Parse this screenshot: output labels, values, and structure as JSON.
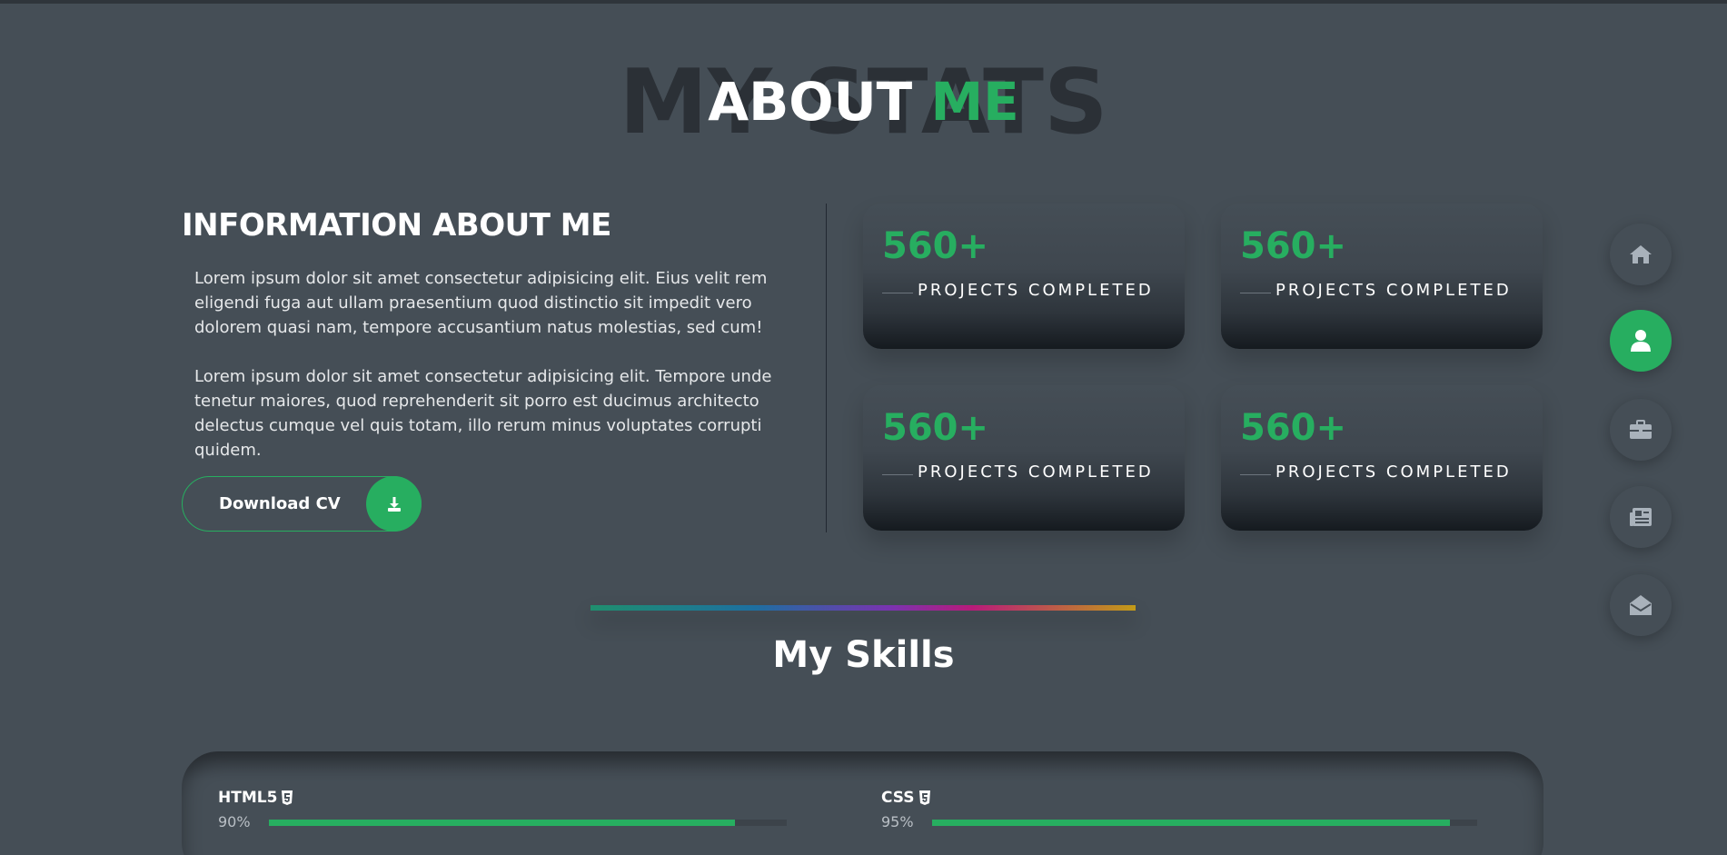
{
  "header": {
    "bg_text": "MY STATS",
    "title_main": "ABOUT",
    "title_accent": "ME"
  },
  "info": {
    "title": "INFORMATION ABOUT ME",
    "paragraph_1": "Lorem ipsum dolor sit amet consectetur adipisicing elit. Eius velit rem eligendi fuga aut ullam praesentium quod distinctio sit impedit vero dolorem quasi nam, tempore accusantium natus molestias, sed cum!",
    "paragraph_2": "Lorem ipsum dolor sit amet consectetur adipisicing elit. Tempore unde tenetur maiores, quod reprehenderit sit porro est ducimus architecto delectus cumque vel quis totam, illo rerum minus voluptates corrupti quidem.",
    "download_label": "Download CV",
    "download_icon": "download-icon"
  },
  "stats": [
    {
      "number": "560+",
      "label": "PROJECTS COMPLETED"
    },
    {
      "number": "560+",
      "label": "PROJECTS COMPLETED"
    },
    {
      "number": "560+",
      "label": "PROJECTS COMPLETED"
    },
    {
      "number": "560+",
      "label": "PROJECTS COMPLETED"
    }
  ],
  "nav": [
    {
      "icon": "home-icon",
      "active": false
    },
    {
      "icon": "user-icon",
      "active": true
    },
    {
      "icon": "briefcase-icon",
      "active": false
    },
    {
      "icon": "newspaper-icon",
      "active": false
    },
    {
      "icon": "envelope-open-icon",
      "active": false
    }
  ],
  "skills": {
    "title": "My Skills",
    "items": [
      {
        "name": "HTML5",
        "percent_text": "90%",
        "level": 90,
        "icon": "html5-icon"
      },
      {
        "name": "CSS",
        "percent_text": "95%",
        "level": 95,
        "icon": "css3-icon"
      }
    ]
  },
  "colors": {
    "background": "#454e56",
    "accent": "#27ae60",
    "title_shadow_text": "#2b3036"
  }
}
